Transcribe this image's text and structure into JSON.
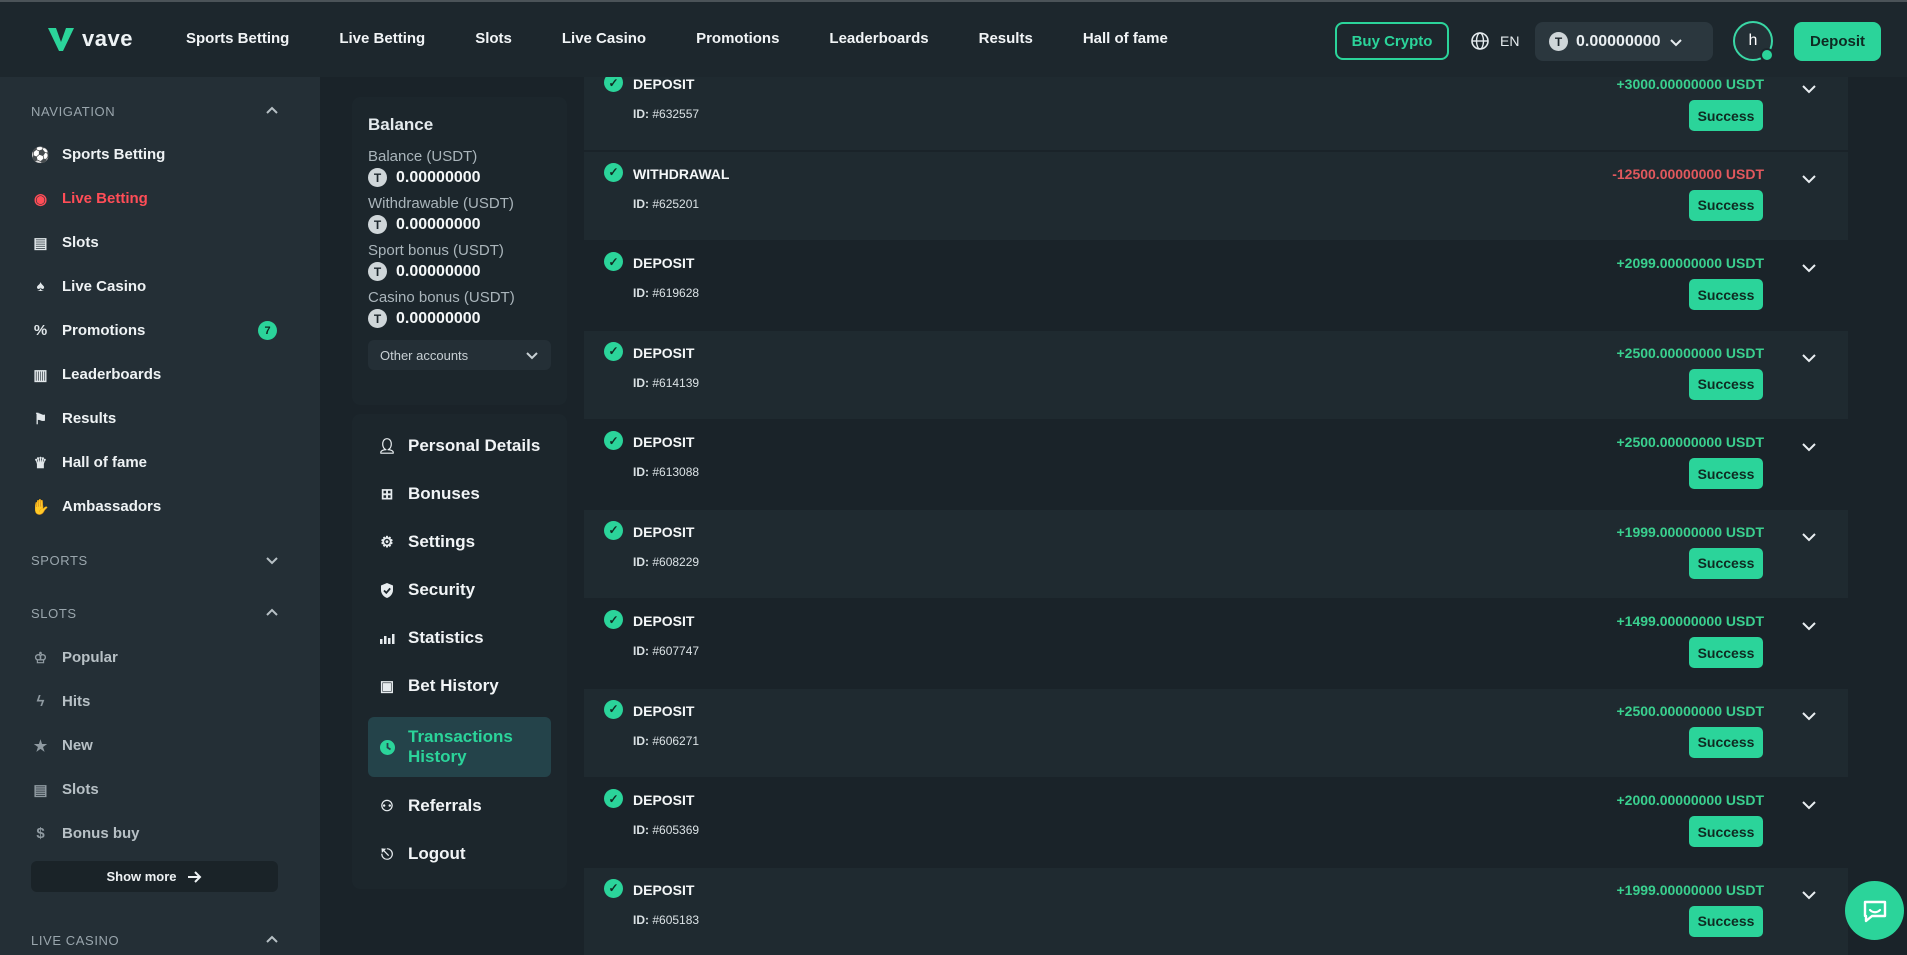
{
  "header": {
    "logo_text": "vave",
    "nav": [
      "Sports Betting",
      "Live Betting",
      "Slots",
      "Live Casino",
      "Promotions",
      "Leaderboards",
      "Results",
      "Hall of fame"
    ],
    "buy_crypto": "Buy Crypto",
    "language": "EN",
    "wallet_balance": "0.00000000",
    "avatar_initial": "h",
    "deposit": "Deposit"
  },
  "sidebar": {
    "navigation_title": "NAVIGATION",
    "items": [
      {
        "label": "Sports Betting",
        "icon": "soccer-ball-icon"
      },
      {
        "label": "Live Betting",
        "icon": "live-signal-icon"
      },
      {
        "label": "Slots",
        "icon": "slot-machine-icon"
      },
      {
        "label": "Live Casino",
        "icon": "cards-icon"
      },
      {
        "label": "Promotions",
        "icon": "promo-icon"
      },
      {
        "label": "Leaderboards",
        "icon": "leaderboard-icon"
      },
      {
        "label": "Results",
        "icon": "flag-icon"
      },
      {
        "label": "Hall of fame",
        "icon": "hall-of-fame-icon"
      },
      {
        "label": "Ambassadors",
        "icon": "handshake-icon"
      }
    ],
    "promotions_badge": "7",
    "sports_title": "SPORTS",
    "slots_title": "SLOTS",
    "slots_items": [
      {
        "label": "Popular",
        "icon": "crown-icon"
      },
      {
        "label": "Hits",
        "icon": "lightning-icon"
      },
      {
        "label": "New",
        "icon": "star-icon"
      },
      {
        "label": "Slots",
        "icon": "slot-machine-icon"
      },
      {
        "label": "Bonus buy",
        "icon": "money-bag-icon"
      }
    ],
    "show_more": "Show more",
    "live_casino_title": "LIVE CASINO"
  },
  "balance": {
    "title": "Balance",
    "rows": [
      {
        "label": "Balance  (USDT)",
        "value": "0.00000000"
      },
      {
        "label": "Withdrawable  (USDT)",
        "value": "0.00000000"
      },
      {
        "label": "Sport bonus  (USDT)",
        "value": "0.00000000"
      },
      {
        "label": "Casino bonus  (USDT)",
        "value": "0.00000000"
      }
    ],
    "other_accounts": "Other accounts"
  },
  "account_menu": [
    {
      "label": "Personal Details",
      "icon": "user-icon"
    },
    {
      "label": "Bonuses",
      "icon": "gift-icon"
    },
    {
      "label": "Settings",
      "icon": "gear-icon"
    },
    {
      "label": "Security",
      "icon": "shield-icon"
    },
    {
      "label": "Statistics",
      "icon": "bar-chart-icon"
    },
    {
      "label": "Bet History",
      "icon": "history-icon"
    },
    {
      "label": "Transactions History",
      "icon": "clock-icon"
    },
    {
      "label": "Referrals",
      "icon": "referrals-icon"
    },
    {
      "label": "Logout",
      "icon": "logout-icon"
    }
  ],
  "transactions": [
    {
      "type": "DEPOSIT",
      "id": "#632557",
      "amount": "+3000.00000000 USDT",
      "status": "Success"
    },
    {
      "type": "WITHDRAWAL",
      "id": "#625201",
      "amount": "-12500.00000000 USDT",
      "status": "Success"
    },
    {
      "type": "DEPOSIT",
      "id": "#619628",
      "amount": "+2099.00000000 USDT",
      "status": "Success"
    },
    {
      "type": "DEPOSIT",
      "id": "#614139",
      "amount": "+2500.00000000 USDT",
      "status": "Success"
    },
    {
      "type": "DEPOSIT",
      "id": "#613088",
      "amount": "+2500.00000000 USDT",
      "status": "Success"
    },
    {
      "type": "DEPOSIT",
      "id": "#608229",
      "amount": "+1999.00000000 USDT",
      "status": "Success"
    },
    {
      "type": "DEPOSIT",
      "id": "#607747",
      "amount": "+1499.00000000 USDT",
      "status": "Success"
    },
    {
      "type": "DEPOSIT",
      "id": "#606271",
      "amount": "+2500.00000000 USDT",
      "status": "Success"
    },
    {
      "type": "DEPOSIT",
      "id": "#605369",
      "amount": "+2000.00000000 USDT",
      "status": "Success"
    },
    {
      "type": "DEPOSIT",
      "id": "#605183",
      "amount": "+1999.00000000 USDT",
      "status": "Success"
    }
  ],
  "id_prefix": "ID:",
  "colors": {
    "accent": "#2bd49a",
    "negative": "#e1585d",
    "live": "#ff4d57"
  }
}
